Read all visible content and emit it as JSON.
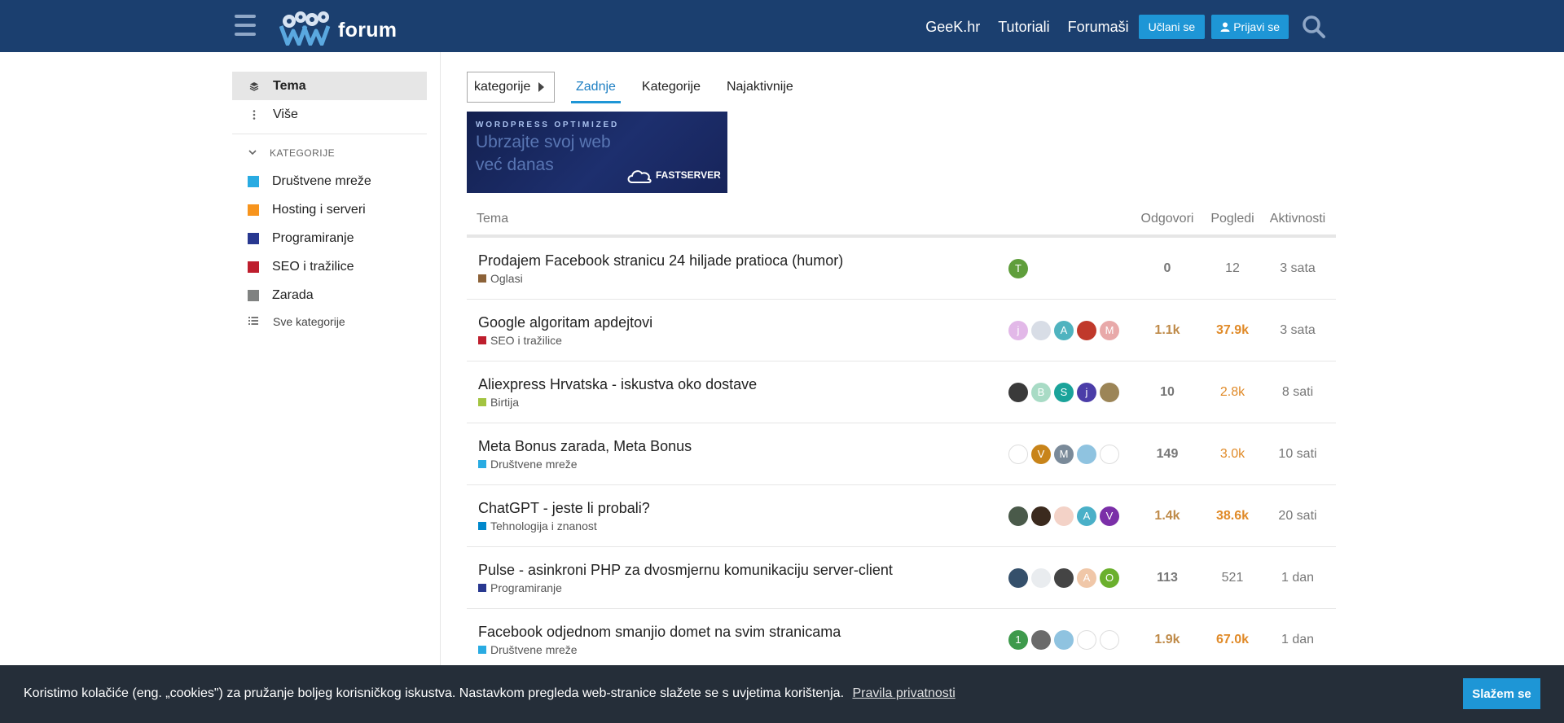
{
  "header": {
    "logo_text": "forum",
    "nav_links": [
      "GeeK.hr",
      "Tutoriali",
      "Forumaši"
    ],
    "signup_label": "Učlani se",
    "login_label": "Prijavi se"
  },
  "sidebar": {
    "items": [
      {
        "label": "Tema",
        "icon": "layers-icon"
      },
      {
        "label": "Više",
        "icon": "more-vertical-icon"
      }
    ],
    "categories_header": "KATEGORIJE",
    "categories": [
      {
        "label": "Društvene mreže",
        "color": "#29abe2"
      },
      {
        "label": "Hosting i serveri",
        "color": "#f7941d"
      },
      {
        "label": "Programiranje",
        "color": "#283890"
      },
      {
        "label": "SEO i tražilice",
        "color": "#be1e2d"
      },
      {
        "label": "Zarada",
        "color": "#808281"
      }
    ],
    "all_categories": "Sve kategorije"
  },
  "controls": {
    "dropdown_label": "kategorije",
    "tabs": [
      "Zadnje",
      "Kategorije",
      "Najaktivnije"
    ],
    "active_tab": "Zadnje"
  },
  "banner": {
    "small_text": "WORDPRESS OPTIMIZED",
    "big_line1": "Ubrzajte svoj web",
    "big_line2": "već danas",
    "brand": "FASTSERVER"
  },
  "table": {
    "headers": {
      "topic": "Tema",
      "replies": "Odgovori",
      "views": "Pogledi",
      "activity": "Aktivnosti"
    },
    "rows": [
      {
        "title": "Prodajem Facebook stranicu 24 hiljade pratioca (humor)",
        "category": "Oglasi",
        "cat_color": "#8c6238",
        "avatars": [
          {
            "letter": "T",
            "color": "#5f9e3b"
          }
        ],
        "replies": "0",
        "views": "12",
        "activity": "3 sata",
        "heat": "none"
      },
      {
        "title": "Google algoritam apdejtovi",
        "category": "SEO i tražilice",
        "cat_color": "#be1e2d",
        "avatars": [
          {
            "letter": "j",
            "color": "#e2b8e8"
          },
          {
            "letter": "",
            "color": "#d8dde6"
          },
          {
            "letter": "A",
            "color": "#4fb3bf"
          },
          {
            "letter": "",
            "color": "#c0392b"
          },
          {
            "letter": "M",
            "color": "#e8a9a9"
          }
        ],
        "replies": "1.1k",
        "views": "37.9k",
        "activity": "3 sata",
        "heat": "high"
      },
      {
        "title": "Aliexpress Hrvatska - iskustva oko dostave",
        "category": "Birtija",
        "cat_color": "#a3c441",
        "avatars": [
          {
            "letter": "",
            "color": "#3a3a3a"
          },
          {
            "letter": "B",
            "color": "#a8dbc5"
          },
          {
            "letter": "S",
            "color": "#1aa39a"
          },
          {
            "letter": "j",
            "color": "#4b3da8"
          },
          {
            "letter": "",
            "color": "#9c8557"
          }
        ],
        "replies": "10",
        "views": "2.8k",
        "activity": "8 sati",
        "heat": "views"
      },
      {
        "title": "Meta Bonus zarada, Meta Bonus",
        "category": "Društvene mreže",
        "cat_color": "#29abe2",
        "avatars": [
          {
            "letter": "",
            "color": "#ffffff"
          },
          {
            "letter": "V",
            "color": "#c8841a"
          },
          {
            "letter": "M",
            "color": "#7a8a99"
          },
          {
            "letter": "",
            "color": "#8fc3e0"
          },
          {
            "letter": "",
            "color": "#ffffff"
          }
        ],
        "replies": "149",
        "views": "3.0k",
        "activity": "10 sati",
        "heat": "views"
      },
      {
        "title": "ChatGPT - jeste li probali?",
        "category": "Tehnologija i znanost",
        "cat_color": "#0088cc",
        "avatars": [
          {
            "letter": "",
            "color": "#4a5a4a"
          },
          {
            "letter": "",
            "color": "#3b2a1e"
          },
          {
            "letter": "",
            "color": "#f3d2c7"
          },
          {
            "letter": "A",
            "color": "#4ab0c8"
          },
          {
            "letter": "V",
            "color": "#7b2fa8"
          }
        ],
        "replies": "1.4k",
        "views": "38.6k",
        "activity": "20 sati",
        "heat": "high"
      },
      {
        "title": "Pulse - asinkroni PHP za dvosmjernu komunikaciju server-client",
        "category": "Programiranje",
        "cat_color": "#283890",
        "avatars": [
          {
            "letter": "",
            "color": "#35506b"
          },
          {
            "letter": "",
            "color": "#e9ecef"
          },
          {
            "letter": "",
            "color": "#444444"
          },
          {
            "letter": "A",
            "color": "#f0c7a8"
          },
          {
            "letter": "O",
            "color": "#6bb02d"
          }
        ],
        "replies": "113",
        "views": "521",
        "activity": "1 dan",
        "heat": "none"
      },
      {
        "title": "Facebook odjednom smanjio domet na svim stranicama",
        "category": "Društvene mreže",
        "cat_color": "#29abe2",
        "avatars": [
          {
            "letter": "1",
            "color": "#3e9a4c"
          },
          {
            "letter": "",
            "color": "#6a6a6a"
          },
          {
            "letter": "",
            "color": "#8fc3e0"
          },
          {
            "letter": "",
            "color": "#ffffff"
          },
          {
            "letter": "",
            "color": "#ffffff"
          }
        ],
        "replies": "1.9k",
        "views": "67.0k",
        "activity": "1 dan",
        "heat": "high"
      }
    ]
  },
  "cookie": {
    "text": "Koristimo kolačiće (eng. „cookies\") za pružanje boljeg korisničkog iskustva. Nastavkom pregleda web-stranice slažete se s uvjetima korištenja.",
    "link": "Pravila privatnosti",
    "button": "Slažem se"
  }
}
